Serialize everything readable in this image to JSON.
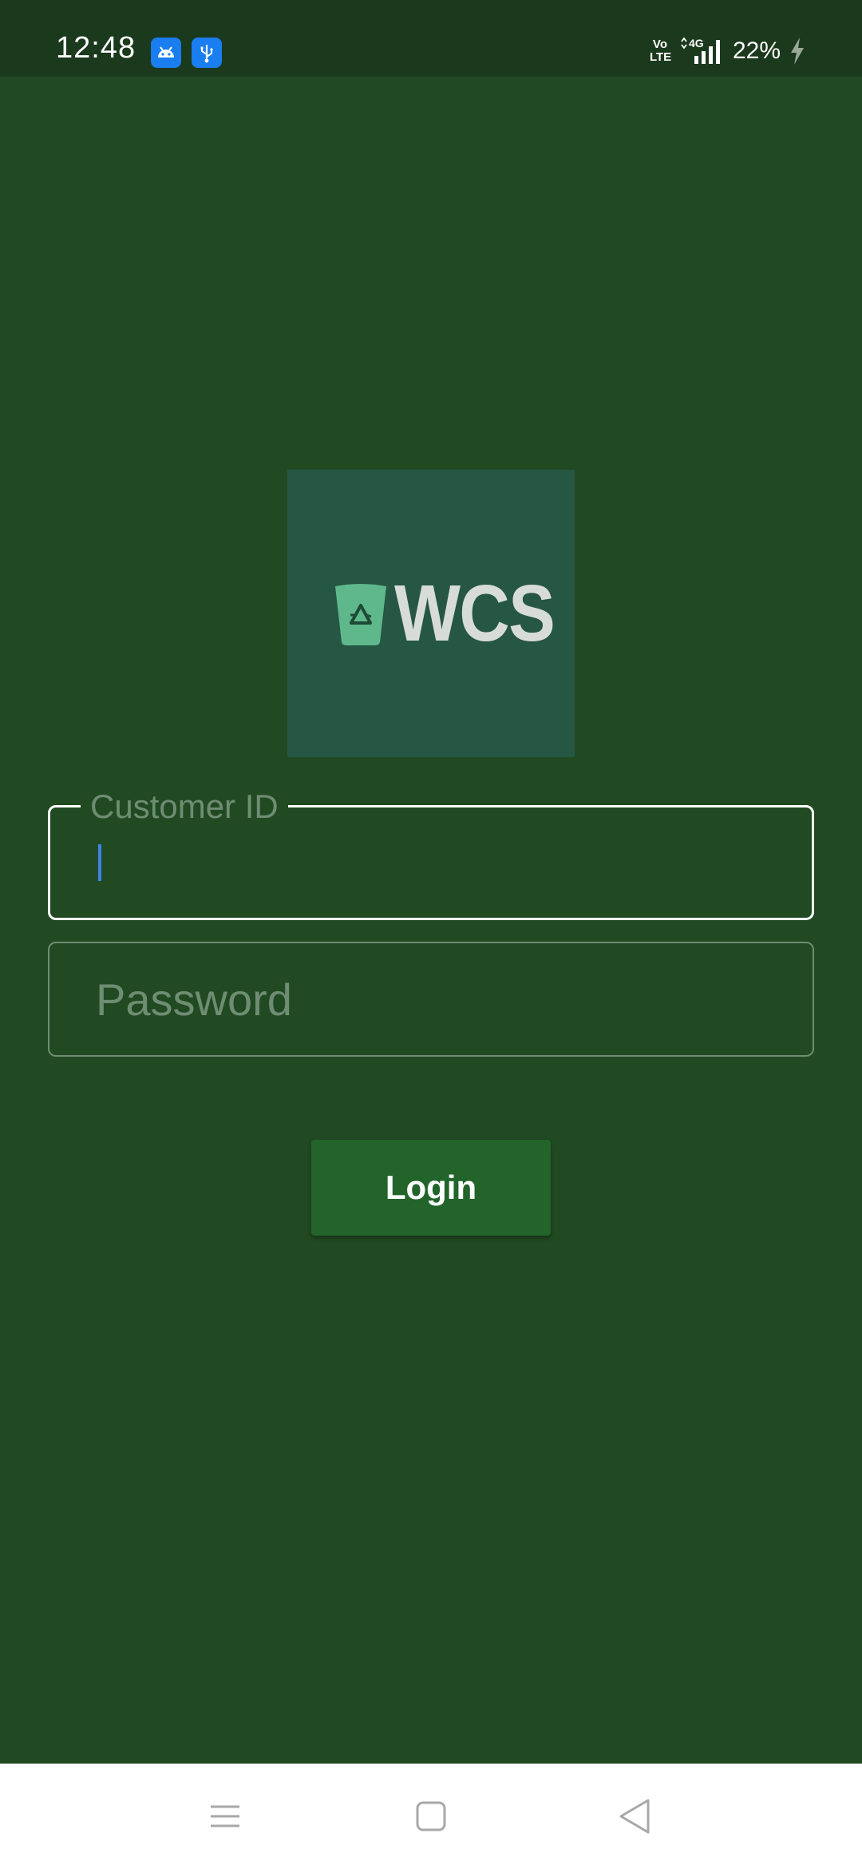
{
  "status_bar": {
    "time": "12:48",
    "app_icons": [
      "android-icon",
      "usb-icon"
    ],
    "volte_line1": "Vo",
    "volte_line2": "LTE",
    "network": "4G",
    "battery": "22%",
    "battery_state_icon": "charging-bolt-icon"
  },
  "logo": {
    "text": "WCS",
    "icon": "recycle-bin-icon"
  },
  "form": {
    "customer_id": {
      "label": "Customer ID",
      "value": ""
    },
    "password": {
      "placeholder": "Password",
      "value": ""
    },
    "login_label": "Login"
  },
  "nav_bar": {
    "icons": [
      "menu-lines-icon",
      "home-square-icon",
      "back-triangle-icon"
    ]
  },
  "colors": {
    "background": "#214a23",
    "status_bar": "#1b391d",
    "logo_box": "#265644",
    "button": "#22642a",
    "muted_text": "#6f8d72",
    "caret": "#3c84e8"
  }
}
